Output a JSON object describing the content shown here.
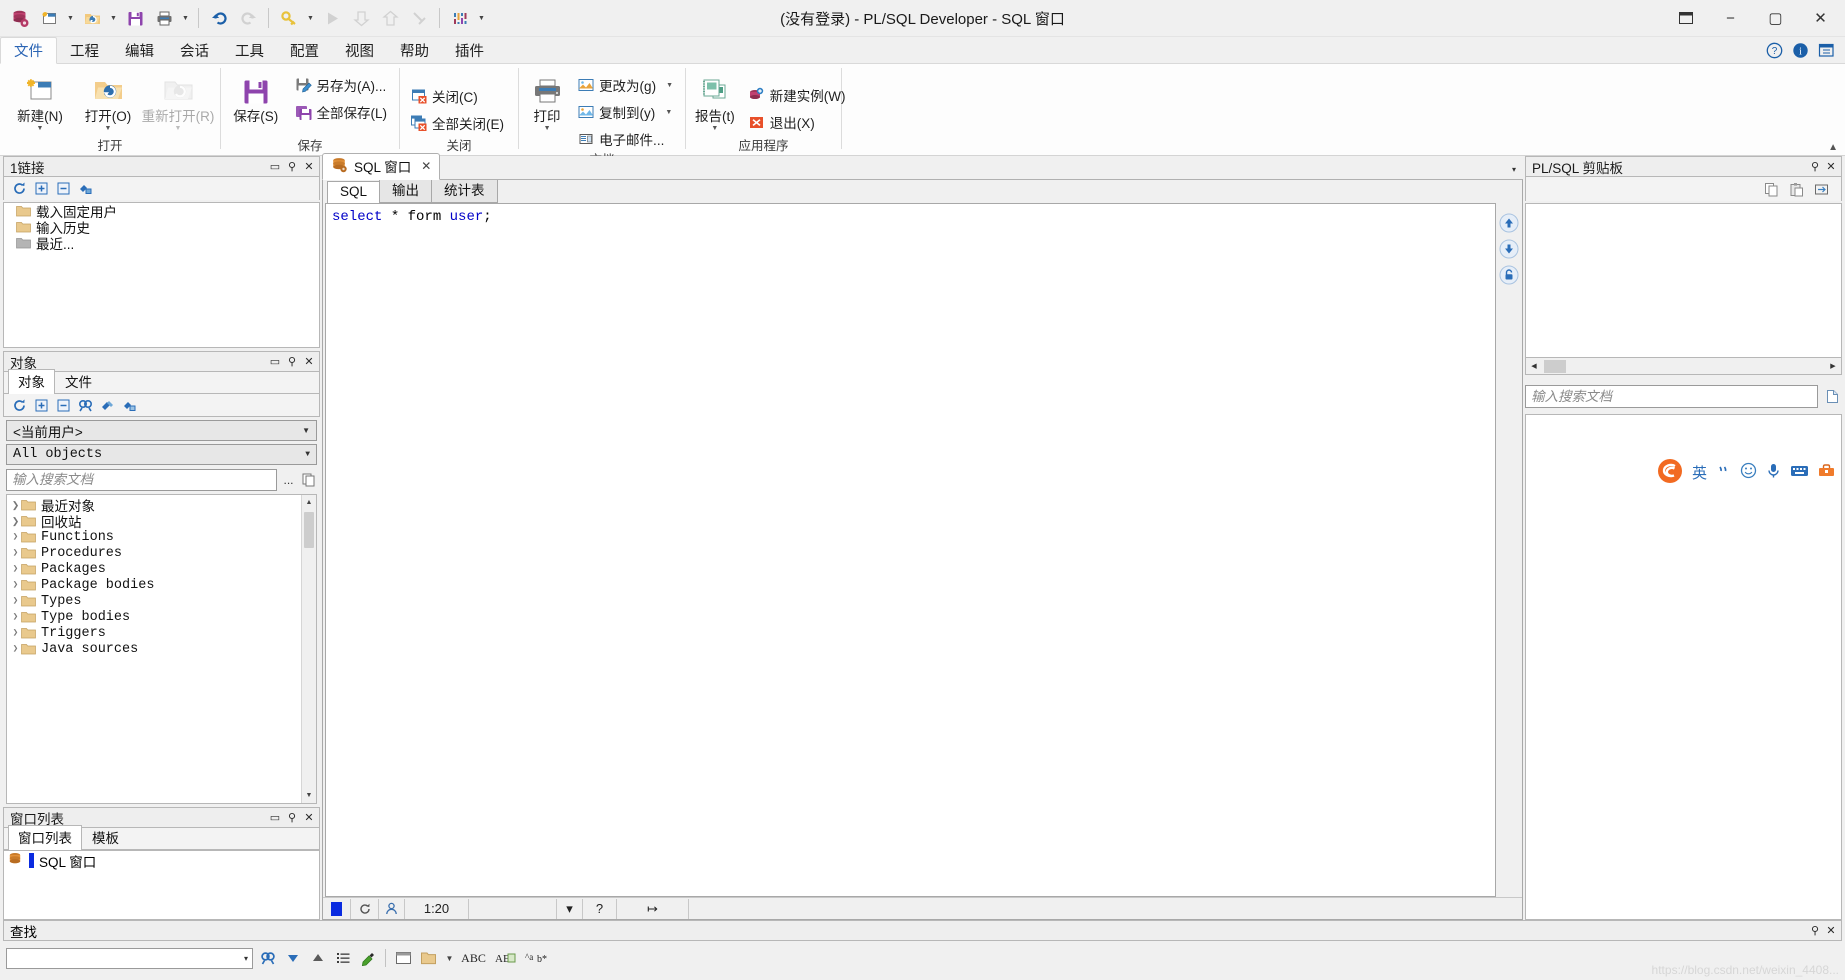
{
  "window": {
    "title": "(没有登录) - PL/SQL Developer - SQL 窗口",
    "minimize": "−",
    "maximize": "▢",
    "close": "✕",
    "restore_icon": "⬓"
  },
  "quick_access": {
    "items": [
      {
        "name": "database-icon",
        "caret": false
      },
      {
        "name": "new-window-icon",
        "caret": true
      },
      {
        "name": "open-folder-icon",
        "caret": true
      },
      {
        "name": "save-icon",
        "caret": false
      },
      {
        "name": "print-icon",
        "caret": true
      },
      {
        "name": "undo-icon",
        "caret": false
      },
      {
        "name": "redo-icon",
        "caret": false
      },
      {
        "name": "key-icon",
        "caret": true
      },
      {
        "name": "execute-icon",
        "caret": false
      },
      {
        "name": "import-icon",
        "caret": false
      },
      {
        "name": "export-icon",
        "caret": false
      },
      {
        "name": "break-icon",
        "caret": false
      },
      {
        "name": "session-icon",
        "caret": false
      },
      {
        "name": "customize-icon",
        "caret": true
      }
    ]
  },
  "menubar": {
    "items": [
      {
        "label": "文件",
        "active": true
      },
      {
        "label": "工程",
        "active": false
      },
      {
        "label": "编辑",
        "active": false
      },
      {
        "label": "会话",
        "active": false
      },
      {
        "label": "工具",
        "active": false
      },
      {
        "label": "配置",
        "active": false
      },
      {
        "label": "视图",
        "active": false
      },
      {
        "label": "帮助",
        "active": false
      },
      {
        "label": "插件",
        "active": false
      }
    ],
    "help_icon": "?",
    "info_icon": "i",
    "window_icon": "▣"
  },
  "ribbon": {
    "collapse_arrow": "▲",
    "groups": [
      {
        "label": "打开",
        "big": [
          {
            "label": "新建(N)",
            "icon": "new-document-icon",
            "caret": true,
            "disabled": false
          },
          {
            "label": "打开(O)",
            "icon": "open-folder-icon",
            "caret": true,
            "disabled": false
          },
          {
            "label": "重新打开(R)",
            "icon": "reopen-folder-icon",
            "caret": true,
            "disabled": true
          }
        ],
        "small": []
      },
      {
        "label": "保存",
        "big": [
          {
            "label": "保存(S)",
            "icon": "save-floppy-icon",
            "caret": false,
            "disabled": false
          }
        ],
        "small": [
          {
            "label": "另存为(A)...",
            "icon": "save-as-icon",
            "caret": false
          },
          {
            "label": "全部保存(L)",
            "icon": "save-all-icon",
            "caret": false
          }
        ]
      },
      {
        "label": "关闭",
        "big": [],
        "small": [
          {
            "label": "关闭(C)",
            "icon": "close-window-icon",
            "caret": false
          },
          {
            "label": "全部关闭(E)",
            "icon": "close-all-icon",
            "caret": false
          }
        ]
      },
      {
        "label": "文档",
        "big": [
          {
            "label": "打印",
            "icon": "printer-icon",
            "caret": true,
            "disabled": false
          }
        ],
        "small": [
          {
            "label": "更改为(g)",
            "icon": "change-to-icon",
            "caret": true
          },
          {
            "label": "复制到(y)",
            "icon": "copy-to-icon",
            "caret": true
          },
          {
            "label": "电子邮件...",
            "icon": "email-icon",
            "caret": false
          }
        ]
      },
      {
        "label": "应用程序",
        "big": [
          {
            "label": "报告(t)",
            "icon": "report-icon",
            "caret": true,
            "disabled": false
          }
        ],
        "small": [
          {
            "label": "新建实例(W)",
            "icon": "new-instance-icon",
            "caret": false
          },
          {
            "label": "退出(X)",
            "icon": "exit-icon",
            "caret": false
          }
        ]
      }
    ]
  },
  "connections_panel": {
    "title": "1链接",
    "buttons": [
      "restore-icon",
      "close-icon"
    ],
    "toolbar": [
      "refresh-icon",
      "expand-all-icon",
      "collapse-all-icon",
      "new-connection-icon"
    ],
    "tree": [
      {
        "label": "载入固定用户",
        "color": "#e8c88a"
      },
      {
        "label": "输入历史",
        "color": "#e8c88a"
      },
      {
        "label": "最近...",
        "color": "#b0b0b0"
      }
    ]
  },
  "objects_panel": {
    "title": "对象",
    "buttons": [
      "restore-icon",
      "pin-icon",
      "close-icon"
    ],
    "tabs": [
      {
        "label": "对象",
        "active": true
      },
      {
        "label": "文件",
        "active": false
      }
    ],
    "toolbar": [
      "refresh-icon",
      "expand-all-icon",
      "collapse-all-icon",
      "find-icon",
      "filter-icon",
      "connect-icon"
    ],
    "user_filter": "<当前用户>",
    "object_filter": "All objects",
    "search_placeholder": "输入搜索文档",
    "search_more": "...",
    "search_copy_icon": "copy-icon",
    "tree": [
      {
        "label": "最近对象",
        "mono": false
      },
      {
        "label": "回收站",
        "mono": false
      },
      {
        "label": "Functions",
        "mono": true
      },
      {
        "label": "Procedures",
        "mono": true
      },
      {
        "label": "Packages",
        "mono": true
      },
      {
        "label": "Package bodies",
        "mono": true
      },
      {
        "label": "Types",
        "mono": true
      },
      {
        "label": "Type bodies",
        "mono": true
      },
      {
        "label": "Triggers",
        "mono": true
      },
      {
        "label": "Java sources",
        "mono": true
      }
    ]
  },
  "window_list_panel": {
    "title": "窗口列表",
    "buttons": [
      "restore-icon",
      "pin-icon",
      "close-icon"
    ],
    "tabs": [
      {
        "label": "窗口列表",
        "active": true
      },
      {
        "label": "模板",
        "active": false
      }
    ],
    "items": [
      {
        "label": "SQL 窗口",
        "icon": "sql-window-icon"
      }
    ]
  },
  "mdi": {
    "tab_label": "SQL 窗口",
    "tab_icon": "database-icon",
    "tab_close": "✕",
    "dropdown": "▾"
  },
  "editor": {
    "tabs": [
      {
        "label": "SQL",
        "active": true
      },
      {
        "label": "输出",
        "active": false
      },
      {
        "label": "统计表",
        "active": false
      }
    ],
    "code_tokens": [
      {
        "text": "select",
        "type": "keyword"
      },
      {
        "text": " * ",
        "type": "plain"
      },
      {
        "text": "form",
        "type": "plain"
      },
      {
        "text": " ",
        "type": "plain"
      },
      {
        "text": "user",
        "type": "keyword"
      },
      {
        "text": ";",
        "type": "plain"
      }
    ],
    "code_plain": "select * form user;",
    "side_buttons": [
      "scroll-up-icon",
      "scroll-down-icon",
      "lock-icon"
    ]
  },
  "status_bar": {
    "cursor_position": "1:20",
    "refresh_icon": "refresh-icon",
    "user_icon": "user-icon",
    "dropdown_icon": "▾",
    "help_icon": "?",
    "resize_icon": "↦"
  },
  "clipboard_panel": {
    "title": "PL/SQL 剪贴板",
    "buttons": [
      "pin-icon",
      "close-icon"
    ],
    "tools": [
      "copy-icon",
      "paste-icon",
      "expand-icon"
    ],
    "search_placeholder": "输入搜索文档",
    "search_button_icon": "new-doc-icon",
    "hscroll_left": "◀",
    "hscroll_right": "▶"
  },
  "ime_bar": {
    "logo": "S",
    "items": [
      "英",
      "half-width-icon",
      "emoji-icon",
      "mic-icon",
      "keyboard-icon",
      "toolbox-icon"
    ]
  },
  "find_panel": {
    "title": "查找",
    "buttons": [
      "pin-icon",
      "close-icon"
    ],
    "combo_value": "",
    "combo_chevron": "▾",
    "buttons_row": [
      "find-icon",
      "find-next-icon",
      "find-prev-icon",
      "list-icon",
      "highlight-icon",
      "window-icon",
      "folder-icon",
      "caret-icon",
      "abc-icon",
      "word-icon",
      "regex-icon"
    ]
  },
  "watermark": "https://blog.csdn.net/weixin_4408..."
}
